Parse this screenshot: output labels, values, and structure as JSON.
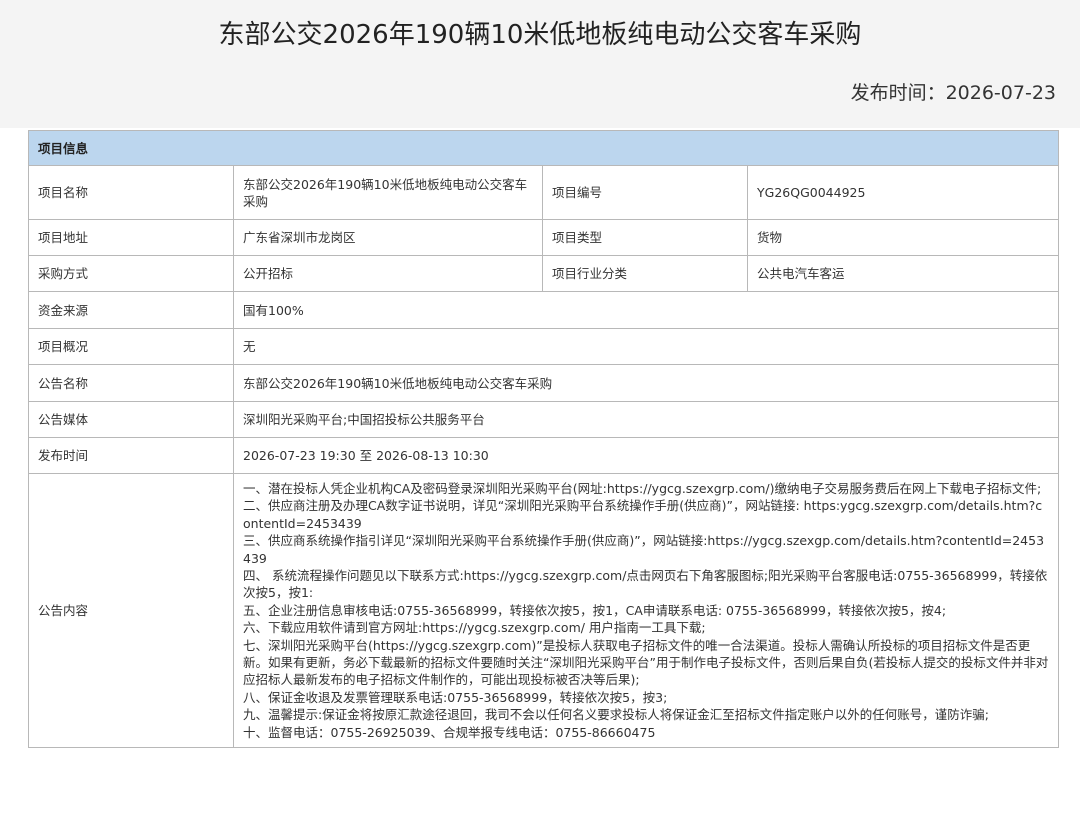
{
  "page": {
    "title": "东部公交2026年190辆10米低地板纯电动公交客车采购",
    "publish_label": "发布时间：",
    "publish_date": "2026-07-23"
  },
  "table": {
    "section_title": "项目信息",
    "project_name_label": "项目名称",
    "project_name": "东部公交2026年190辆10米低地板纯电动公交客车采购",
    "project_no_label": "项目编号",
    "project_no": "YG26QG0044925",
    "project_address_label": "项目地址",
    "project_address": "广东省深圳市龙岗区",
    "project_type_label": "项目类型",
    "project_type": "货物",
    "purchase_method_label": "采购方式",
    "purchase_method": "公开招标",
    "industry_label": "项目行业分类",
    "industry": "公共电汽车客运",
    "fund_source_label": "资金来源",
    "fund_source": "国有100%",
    "overview_label": "项目概况",
    "overview": "无",
    "notice_name_label": "公告名称",
    "notice_name": "东部公交2026年190辆10米低地板纯电动公交客车采购",
    "notice_media_label": "公告媒体",
    "notice_media": "深圳阳光采购平台;中国招投标公共服务平台",
    "publish_time_label": "发布时间",
    "publish_time": "2026-07-23 19:30 至 2026-08-13 10:30",
    "content_label": "公告内容",
    "content_lines": [
      "一、潜在投标人凭企业机构CA及密码登录深圳阳光采购平台(网址:https://ygcg.szexgrp.com/)缴纳电子交易服务费后在网上下载电子招标文件;",
      "二、供应商注册及办理CA数字证书说明，详见“深圳阳光采购平台系统操作手册(供应商)”，网站链接: https:ygcg.szexgrp.com/details.htm?contentId=2453439",
      "三、供应商系统操作指引详见“深圳阳光采购平台系统操作手册(供应商)”，网站链接:https://ygcg.szexgp.com/details.htm?contentId=2453439",
      "四、 系统流程操作问题见以下联系方式:https://ygcg.szexgrp.com/点击网页右下角客服图标;阳光采购平台客服电话:0755-36568999，转接依次按5，按1:",
      "五、企业注册信息审核电话:0755-36568999，转接依次按5，按1，CA申请联系电话: 0755-36568999，转接依次按5，按4;",
      "六、下载应用软件请到官方网址:https://ygcg.szexgrp.com/ 用户指南一工具下载;",
      "七、深圳阳光采购平台(https://ygcg.szexgrp.com)”是投标人获取电子招标文件的唯一合法渠道。投标人需确认所投标的项目招标文件是否更新。如果有更新，务必下载最新的招标文件要随时关注“深圳阳光采购平台”用于制作电子投标文件，否则后果自负(若投标人提交的投标文件并非对应招标人最新发布的电子招标文件制作的，可能出现投标被否决等后果);",
      "八、保证金收退及发票管理联系电话:0755-36568999，转接依次按5，按3;",
      "九、温馨提示:保证金将按原汇款途径退回，我司不会以任何名义要求投标人将保证金汇至招标文件指定账户以外的任何账号，谨防诈骗;",
      "十、监督电话：0755-26925039、合规举报专线电话：0755-86660475"
    ]
  }
}
